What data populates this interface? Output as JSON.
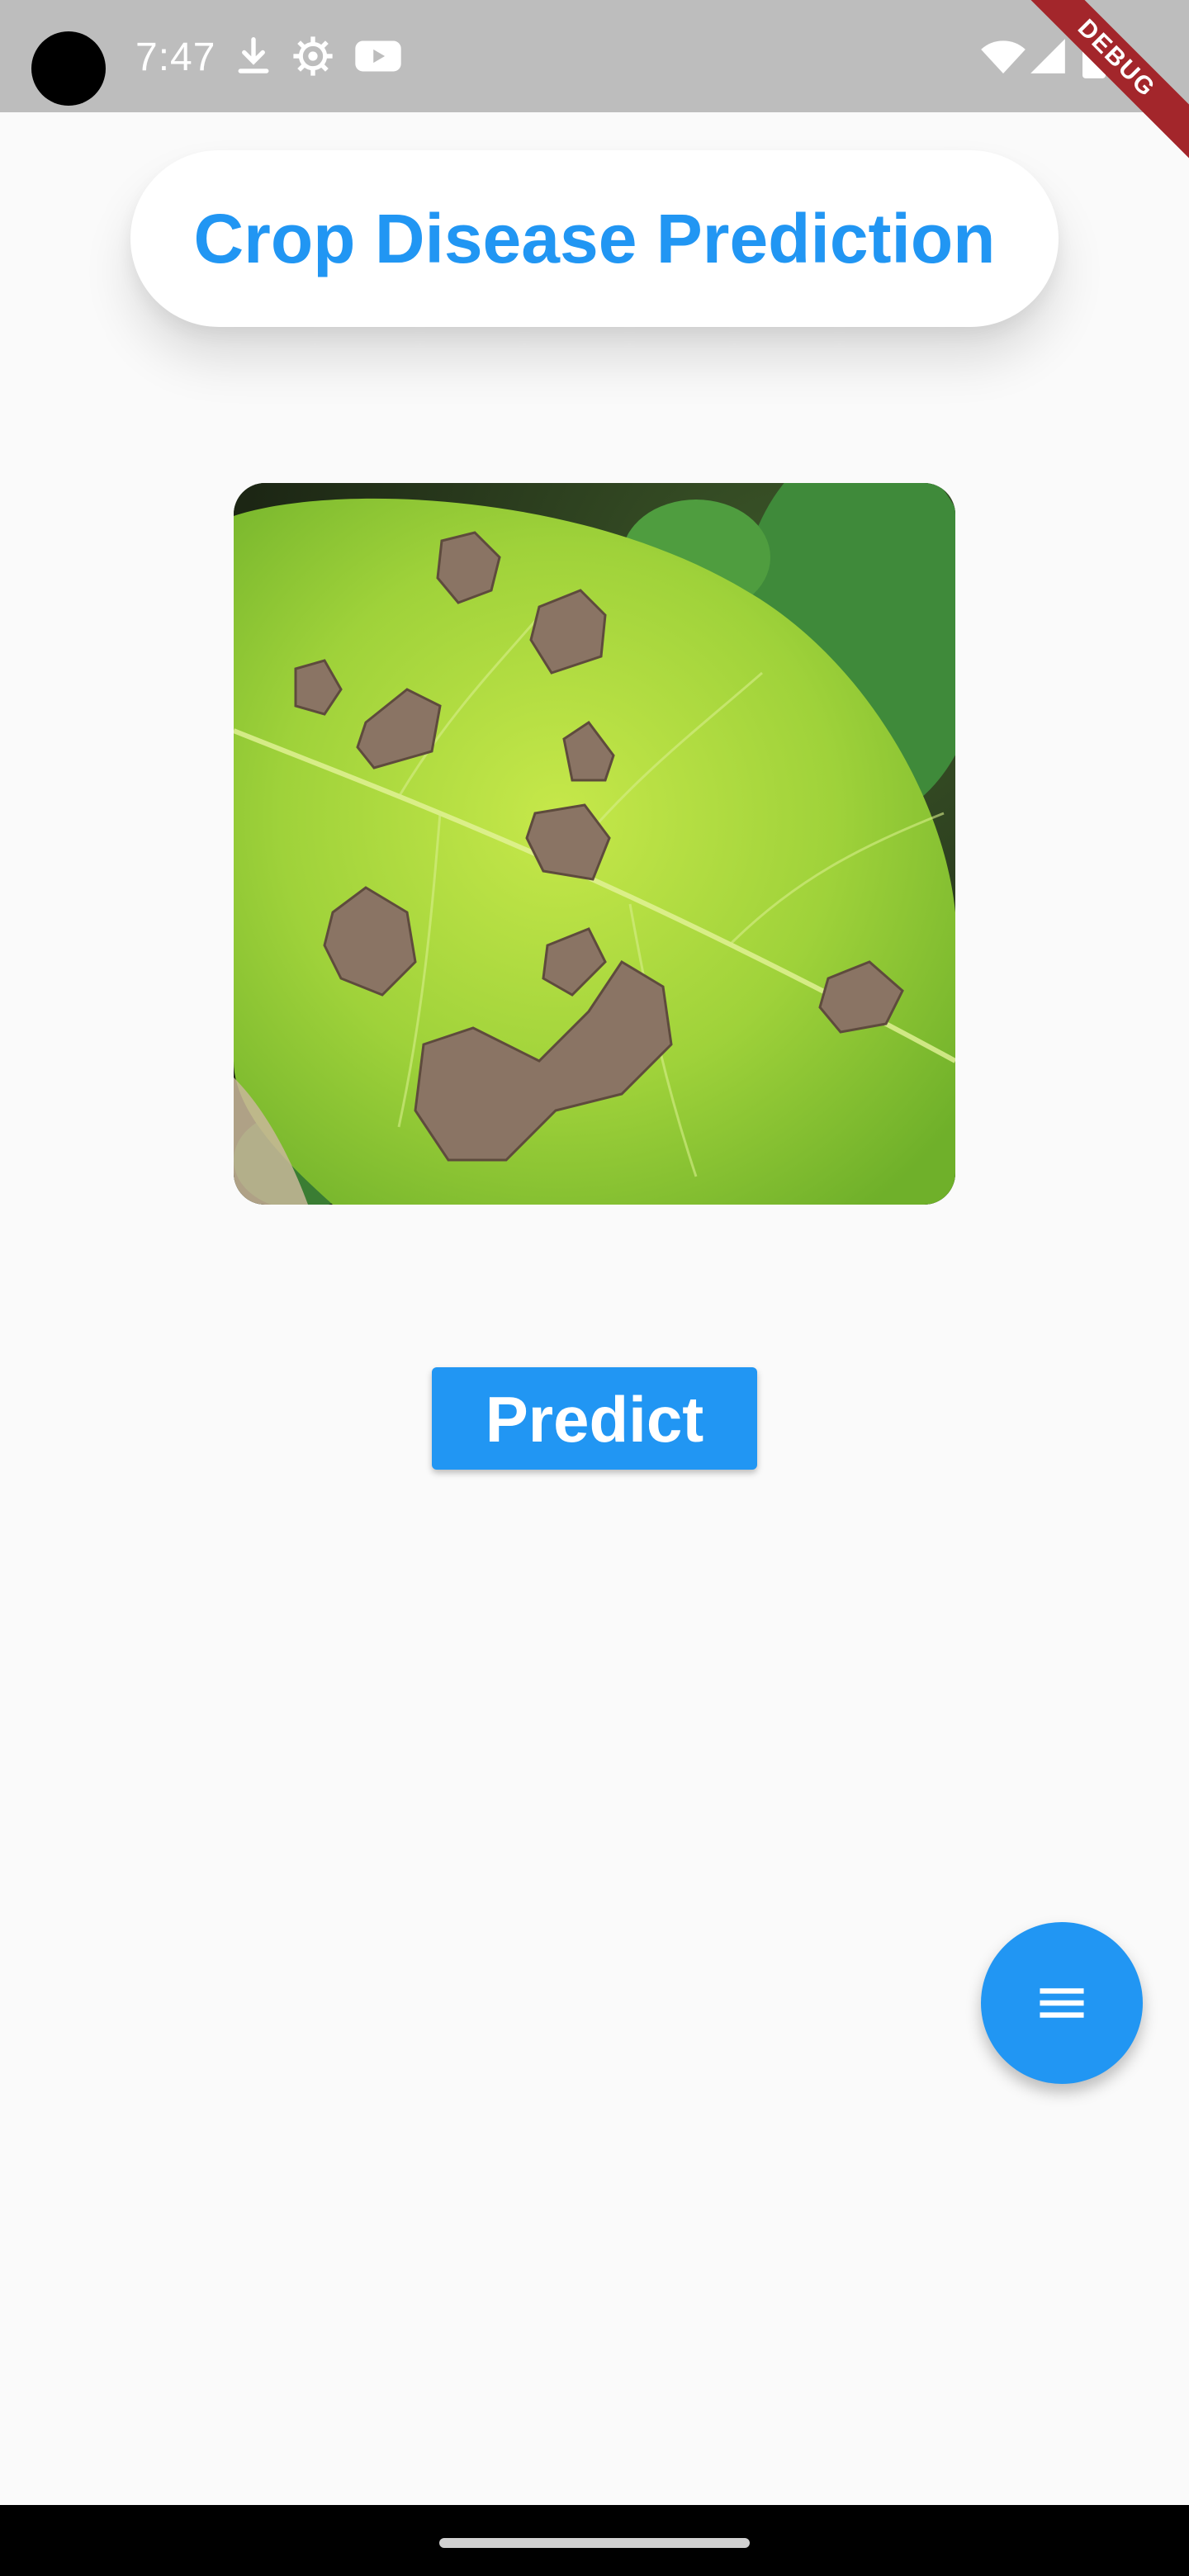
{
  "status_bar": {
    "time": "7:47",
    "icons_left": [
      "download-icon",
      "settings-icon",
      "youtube-icon"
    ],
    "icons_right": [
      "wifi-icon",
      "signal-icon",
      "battery-icon"
    ]
  },
  "debug_banner": {
    "label": "DEBUG"
  },
  "header": {
    "title": "Crop Disease Prediction"
  },
  "image": {
    "subject": "leaf-with-disease-spots"
  },
  "actions": {
    "predict_label": "Predict",
    "fab_icon": "menu-icon"
  },
  "colors": {
    "accent": "#2196f3",
    "background": "#fafafa",
    "status_bar": "#bdbdbd"
  }
}
